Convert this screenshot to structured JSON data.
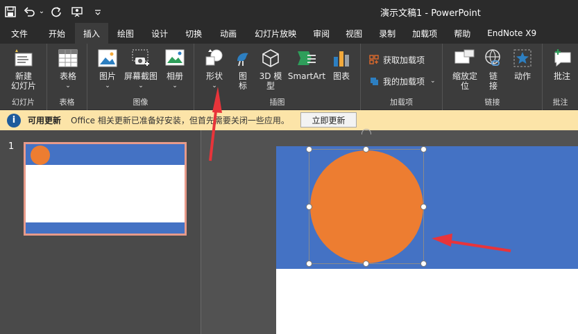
{
  "app": {
    "window_title": "演示文稿1  -  PowerPoint"
  },
  "quick_access": {
    "save_icon": "💾",
    "undo_icon": "↶",
    "undo_drop": "⌄",
    "redo_icon": "↻",
    "present_icon": "▤",
    "customize_icon": "⌄"
  },
  "tabs": [
    {
      "label": "文件"
    },
    {
      "label": "开始"
    },
    {
      "label": "插入"
    },
    {
      "label": "绘图"
    },
    {
      "label": "设计"
    },
    {
      "label": "切换"
    },
    {
      "label": "动画"
    },
    {
      "label": "幻灯片放映"
    },
    {
      "label": "审阅"
    },
    {
      "label": "视图"
    },
    {
      "label": "录制"
    },
    {
      "label": "加载项"
    },
    {
      "label": "帮助"
    },
    {
      "label": "EndNote X9"
    }
  ],
  "ribbon": {
    "slides": {
      "group": "幻灯片",
      "new_slide_l1": "新建",
      "new_slide_l2": "幻灯片"
    },
    "tables": {
      "group": "表格",
      "table": "表格"
    },
    "images": {
      "group": "图像",
      "pictures": "图片",
      "screenshot": "屏幕截图",
      "album": "相册"
    },
    "illustrations": {
      "group": "插图",
      "shapes": "形状",
      "icons_l1": "图",
      "icons_l2": "标",
      "model3d_l1": "3D 模",
      "model3d_l2": "型",
      "smartart": "SmartArt",
      "chart": "图表"
    },
    "addins": {
      "group": "加载项",
      "get_addins": "获取加载项",
      "my_addins": "我的加载项"
    },
    "links": {
      "group": "链接",
      "zoom_l1": "缩放定",
      "zoom_l2": "位",
      "link_l1": "链",
      "link_l2": "接",
      "action": "动作"
    },
    "comments": {
      "group": "批注",
      "comment": "批注"
    }
  },
  "infobar": {
    "title": "可用更新",
    "message": "Office 相关更新已准备好安装，但首先需要关闭一些应用。",
    "button": "立即更新"
  },
  "slides_panel": {
    "slide_number": "1"
  },
  "colors": {
    "accent_blue": "#4472c4",
    "accent_orange": "#ed7d31",
    "annotation_red": "#e8343a"
  }
}
